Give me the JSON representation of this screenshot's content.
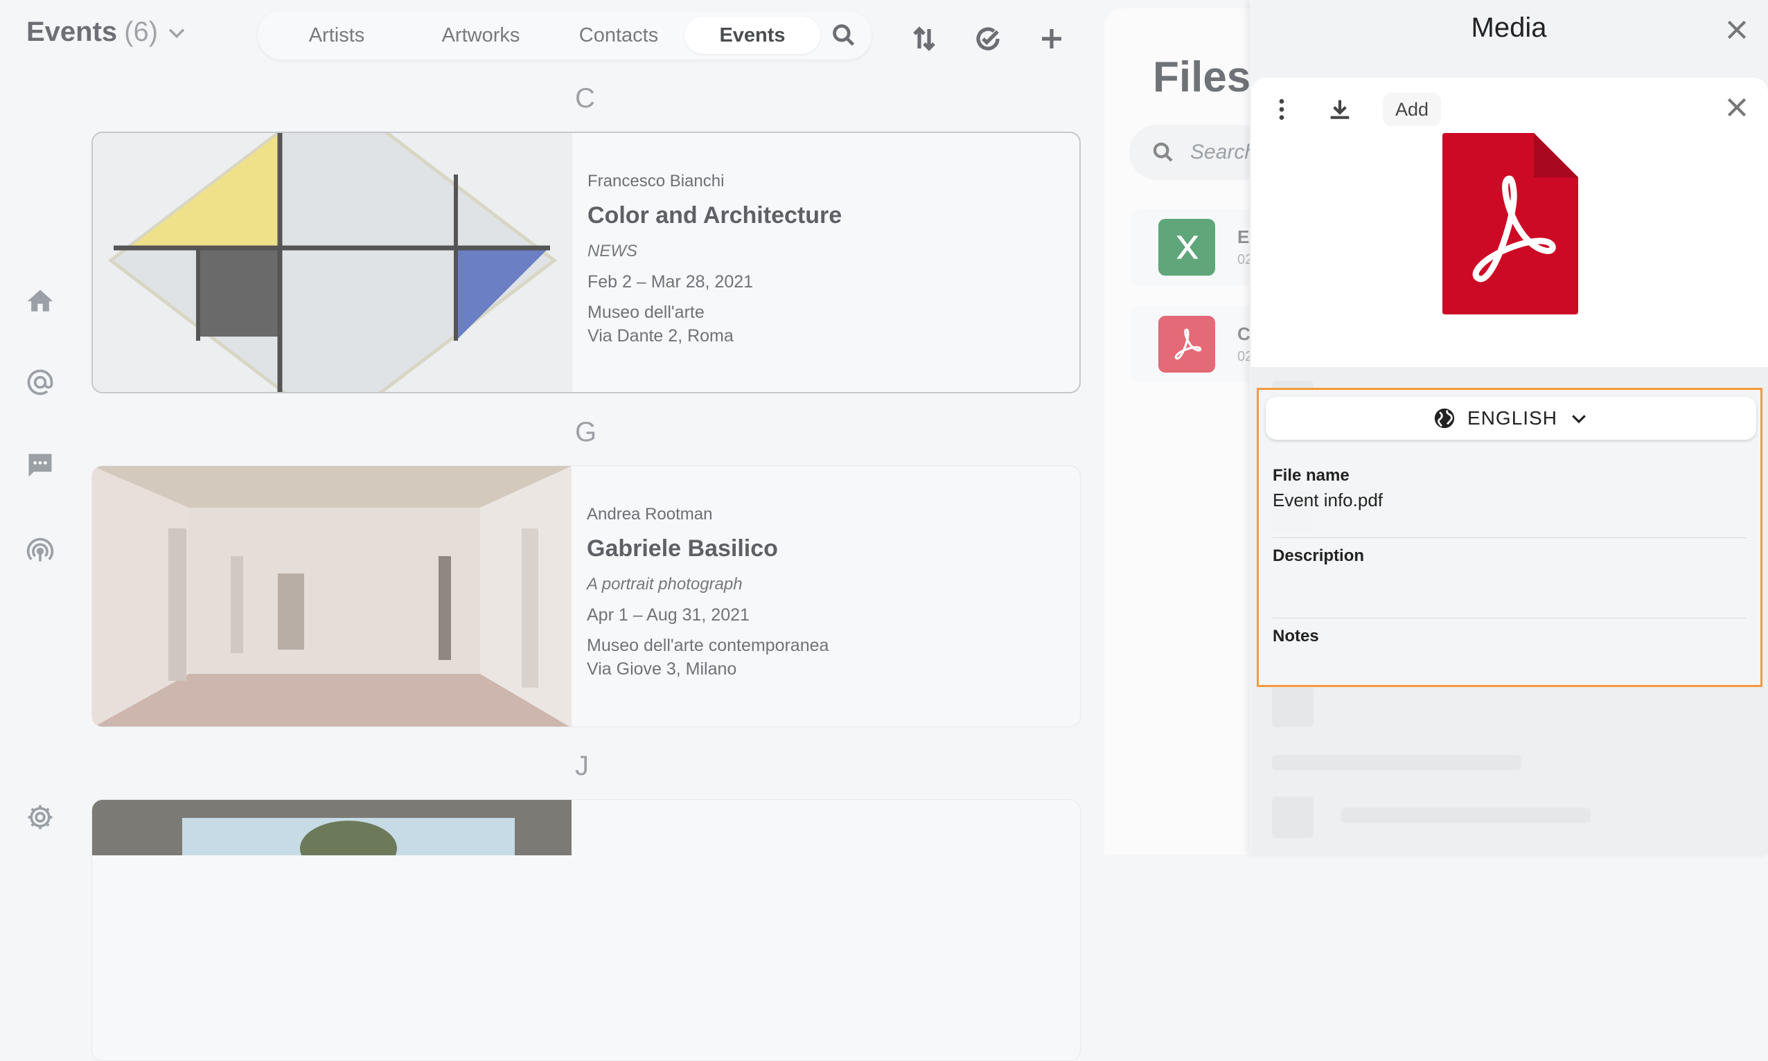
{
  "header": {
    "title": "Events",
    "count": "(6)",
    "tabs": [
      {
        "label": "Artists"
      },
      {
        "label": "Artworks"
      },
      {
        "label": "Contacts"
      },
      {
        "label": "Events",
        "active": true
      }
    ]
  },
  "sections": [
    {
      "letter": "C"
    },
    {
      "letter": "G"
    },
    {
      "letter": "J"
    }
  ],
  "events": [
    {
      "artist": "Francesco Bianchi",
      "title": "Color and Architecture",
      "subtitle": "NEWS",
      "dates": "Feb 2 – Mar 28, 2021",
      "venue": "Museo dell'arte",
      "address": "Via Dante 2, Roma"
    },
    {
      "artist": "Andrea Rootman",
      "title": "Gabriele Basilico",
      "subtitle": "A portrait photograph",
      "dates": "Apr 1 – Aug 31, 2021",
      "venue": "Museo dell'arte contemporanea",
      "address": "Via Giove 3, Milano"
    }
  ],
  "files": {
    "title": "Files",
    "search_placeholder": "Search",
    "items": [
      {
        "name": "El",
        "date": "02",
        "type": "excel"
      },
      {
        "name": "C",
        "date": "02",
        "type": "pdf"
      }
    ]
  },
  "media": {
    "title": "Media",
    "add_label": "Add",
    "language": "ENGLISH",
    "fields": [
      {
        "label": "File name",
        "value": "Event info.pdf"
      },
      {
        "label": "Description",
        "value": ""
      },
      {
        "label": "Notes",
        "value": ""
      }
    ]
  },
  "colors": {
    "accent_outline": "#f39a3b",
    "pdf_red": "#cd0a26",
    "excel_green": "#5fa77a"
  },
  "icons": [
    "home-icon",
    "at-icon",
    "chat-icon",
    "broadcast-icon",
    "settings-icon",
    "search-icon",
    "sort-icon",
    "check-circle-icon",
    "plus-icon",
    "close-icon",
    "more-vertical-icon",
    "download-icon",
    "globe-icon",
    "chevron-down-icon",
    "pdf-icon",
    "excel-icon"
  ]
}
